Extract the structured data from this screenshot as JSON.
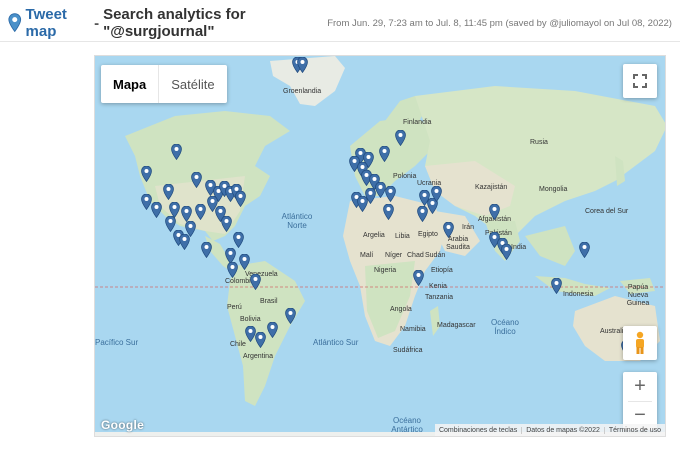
{
  "header": {
    "app_link": "Tweet map",
    "dash": "-",
    "title": "Search analytics for \"@surgjournal\"",
    "meta": "From Jun. 29, 7:23 am to Jul. 8, 11:45 pm  (saved by @juliomayol on Jul 08, 2022)"
  },
  "map": {
    "type_options": [
      "Mapa",
      "Satélite"
    ],
    "active_type": "Mapa",
    "fullscreen_icon": "fullscreen-icon",
    "pegman_icon": "pegman-icon",
    "zoom_in": "+",
    "zoom_out": "−",
    "google": "Google",
    "attribution": [
      "Combinaciones de teclas",
      "Datos de mapas ©2022",
      "Términos de uso"
    ],
    "labels": [
      {
        "text": "Groenlandia"
      },
      {
        "text": "Finlandia"
      },
      {
        "text": "Rusia"
      },
      {
        "text": "Polonia"
      },
      {
        "text": "Ucrania"
      },
      {
        "text": "Kazajistán"
      },
      {
        "text": "Mongolia"
      },
      {
        "text": "Corea del Sur"
      },
      {
        "text": "Afganistán"
      },
      {
        "text": "Irán"
      },
      {
        "text": "Pakistán"
      },
      {
        "text": "India"
      },
      {
        "text": "Argelia"
      },
      {
        "text": "Libia"
      },
      {
        "text": "Egipto"
      },
      {
        "text": "Arabia Saudita"
      },
      {
        "text": "Malí"
      },
      {
        "text": "Níger"
      },
      {
        "text": "Chad"
      },
      {
        "text": "Sudán"
      },
      {
        "text": "Nigeria"
      },
      {
        "text": "Etiopía"
      },
      {
        "text": "Kenia"
      },
      {
        "text": "Tanzania"
      },
      {
        "text": "Angola"
      },
      {
        "text": "Namibia"
      },
      {
        "text": "Madagascar"
      },
      {
        "text": "Sudáfrica"
      },
      {
        "text": "Indonesia"
      },
      {
        "text": "Papúa Nueva Guinea"
      },
      {
        "text": "Australia"
      },
      {
        "text": "Venezuela"
      },
      {
        "text": "Colombia"
      },
      {
        "text": "Perú"
      },
      {
        "text": "Brasil"
      },
      {
        "text": "Bolivia"
      },
      {
        "text": "Chile"
      },
      {
        "text": "Argentina"
      }
    ],
    "ocean_labels": [
      {
        "text": "Atlántico Norte"
      },
      {
        "text": "Pacífico Sur"
      },
      {
        "text": "Atlántico Sur"
      },
      {
        "text": "Océano Índico"
      },
      {
        "text": "Océano Antártico"
      }
    ]
  }
}
